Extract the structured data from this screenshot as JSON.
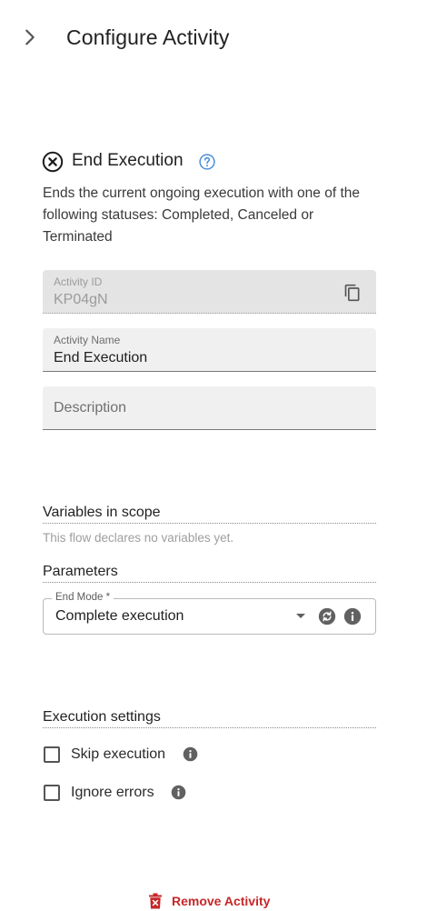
{
  "header": {
    "title": "Configure Activity",
    "toggle_icon": "chevron-right-icon"
  },
  "activity": {
    "icon": "close-circle-icon",
    "title": "End Execution",
    "help_icon": "help-circle-icon",
    "description": "Ends the current ongoing execution with one of the following statuses: Completed, Canceled or Terminated"
  },
  "fields": {
    "activity_id": {
      "label": "Activity ID",
      "value": "KP04gN",
      "icon": "copy-icon"
    },
    "activity_name": {
      "label": "Activity Name",
      "value": "End Execution"
    },
    "description": {
      "placeholder": "Description"
    }
  },
  "variables": {
    "title": "Variables in scope",
    "empty_text": "This flow declares no variables yet."
  },
  "parameters": {
    "title": "Parameters",
    "end_mode": {
      "label": "End Mode *",
      "value": "Complete execution"
    }
  },
  "execution_settings": {
    "title": "Execution settings",
    "skip": {
      "label": "Skip execution",
      "checked": false
    },
    "ignore": {
      "label": "Ignore errors",
      "checked": false
    }
  },
  "footer": {
    "remove_label": "Remove Activity",
    "icon": "trash-x-icon"
  },
  "colors": {
    "accent_blue": "#4a8fd8",
    "danger_red": "#c62828",
    "field_bg": "#f0f0f0",
    "disabled_bg": "#e4e4e4"
  }
}
